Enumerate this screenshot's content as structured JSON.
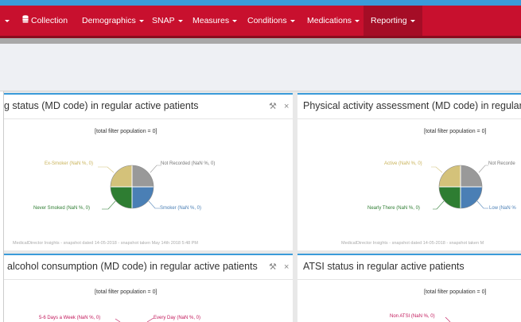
{
  "nav": {
    "items": [
      {
        "label": "Collection",
        "icon": "database-icon"
      },
      {
        "label": "Demographics"
      },
      {
        "label": "SNAP"
      },
      {
        "label": "Measures"
      },
      {
        "label": "Conditions"
      },
      {
        "label": "Medications"
      },
      {
        "label": "Reporting",
        "active": true
      }
    ],
    "colors": {
      "bar": "#c8102e",
      "active": "#a50d26",
      "accent": "#3a9bd9"
    }
  },
  "panels": [
    {
      "title": "g status (MD code) in regular active patients",
      "filter": "[total filter population = 0]",
      "slices": [
        {
          "label": "Ex-Smoker (NaN %, 0)",
          "color": "#d4c27a"
        },
        {
          "label": "Not Recorded (NaN %, 0)",
          "color": "#999999"
        },
        {
          "label": "Never Smoked (NaN %, 0)",
          "color": "#2e7d32"
        },
        {
          "label": "Smoker (NaN %, 0)",
          "color": "#4a7fb5"
        }
      ],
      "footer": "MedicalDirector Insights - snapshot dated 14-05-2018 - snapshot taken May 14th 2018 5:48 PM",
      "tools": {
        "wrench": "⚒",
        "close": "×"
      }
    },
    {
      "title": "Physical activity assessment (MD code) in regular acti",
      "filter": "[total filter population = 0]",
      "slices": [
        {
          "label": "Active (NaN %, 0)",
          "color": "#d4c27a"
        },
        {
          "label": "Not Recorde",
          "color": "#999999"
        },
        {
          "label": "Nearly There (NaN %, 0)",
          "color": "#2e7d32"
        },
        {
          "label": "Low (NaN %",
          "color": "#4a7fb5"
        }
      ],
      "footer": "MedicalDirector Insights - snapshot dated 14-05-2018 - snapshot taken M"
    },
    {
      "title": "alcohol consumption (MD code) in regular active patients",
      "filter": "[total filter population = 0]",
      "slices": [
        {
          "label": "5-6 Days a Week (NaN %, 0)",
          "color": "#c2185b"
        },
        {
          "label": "Every Day (NaN %, 0)",
          "color": "#c2185b"
        }
      ],
      "tools": {
        "wrench": "⚒",
        "close": "×"
      }
    },
    {
      "title": "ATSI status in regular active patients",
      "filter": "[total filter population = 0]",
      "slices": [
        {
          "label": "Non ATSI (NaN %, 0)",
          "color": "#c2185b"
        }
      ]
    }
  ]
}
